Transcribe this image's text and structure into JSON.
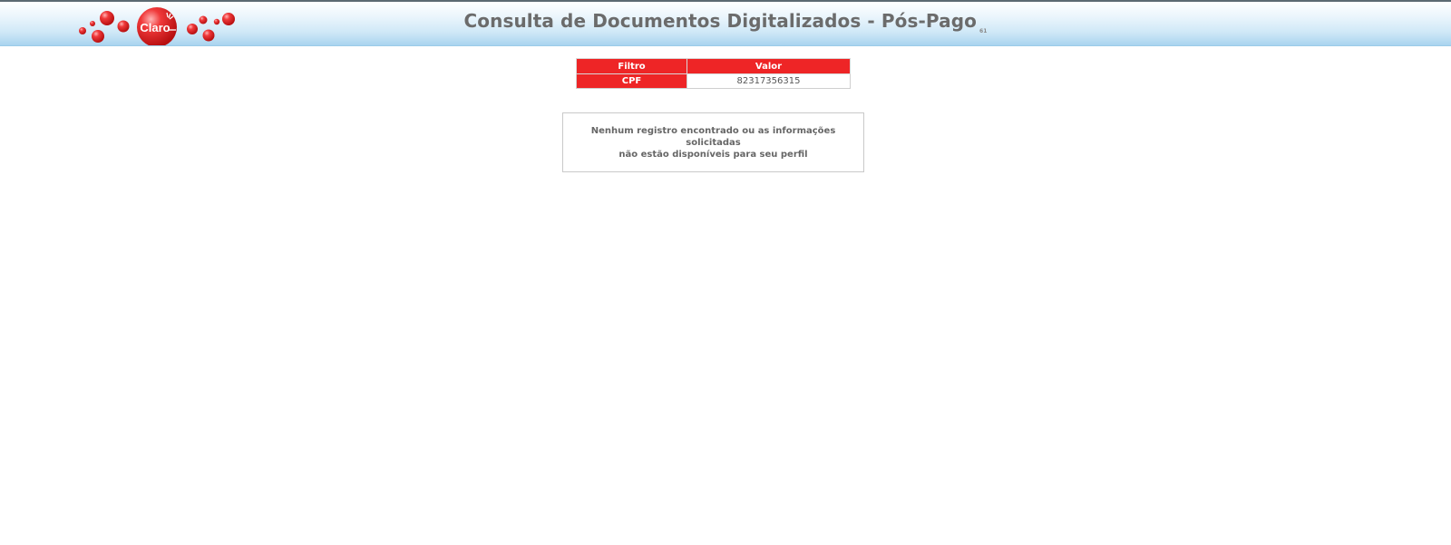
{
  "header": {
    "logo_text": "Claro",
    "title": "Consulta de Documentos Digitalizados - Pós-Pago",
    "title_suffix": "61"
  },
  "filters": {
    "columns": [
      "Filtro",
      "Valor"
    ],
    "rows": [
      {
        "key": "CPF",
        "value": "82317356315"
      }
    ]
  },
  "message": {
    "line1": "Nenhum registro encontrado ou as informações solicitadas",
    "line2": "não estão disponíveis para seu perfil"
  },
  "colors": {
    "brand_red": "#ee2526",
    "header_blue": "#a9d4ef"
  }
}
